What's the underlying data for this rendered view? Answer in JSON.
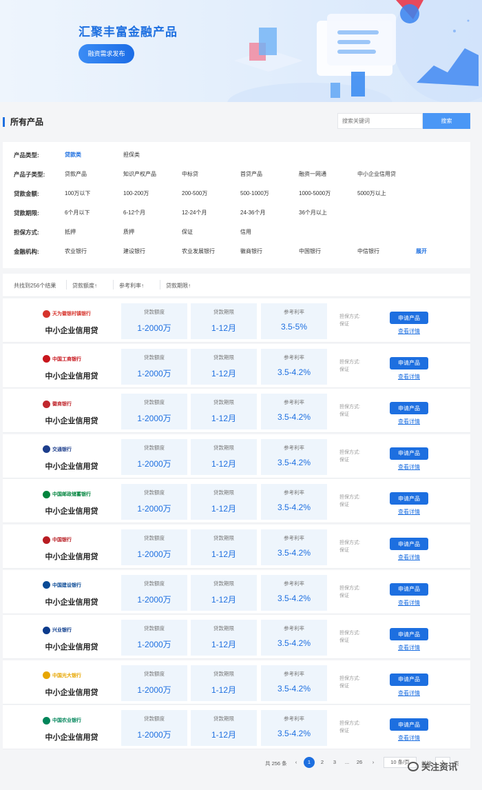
{
  "banner": {
    "title": "汇聚丰富金融产品",
    "button": "融资需求发布"
  },
  "section": {
    "title": "所有产品"
  },
  "search": {
    "placeholder": "搜索关键词",
    "button": "搜索"
  },
  "filters": [
    {
      "label": "产品类型:",
      "options": [
        "贷款类",
        "担保类"
      ],
      "selected": 0
    },
    {
      "label": "产品子类型:",
      "options": [
        "贷款产品",
        "知识产权产品",
        "中标贷",
        "首贷产品",
        "融资一网通",
        "中小企业信用贷"
      ]
    },
    {
      "label": "贷款金额:",
      "options": [
        "100万以下",
        "100-200万",
        "200-500万",
        "500-1000万",
        "1000-5000万",
        "5000万以上"
      ]
    },
    {
      "label": "贷款期限:",
      "options": [
        "6个月以下",
        "6-12个月",
        "12-24个月",
        "24-36个月",
        "36个月以上"
      ]
    },
    {
      "label": "担保方式:",
      "options": [
        "抵押",
        "质押",
        "保证",
        "信用"
      ]
    },
    {
      "label": "金融机构:",
      "options": [
        "农业银行",
        "建设银行",
        "农业发展银行",
        "徽商银行",
        "中国银行",
        "中信银行"
      ],
      "more": "展开"
    }
  ],
  "sortbar": {
    "count": "共找到256个结果",
    "sorts": [
      "贷款额度↑",
      "参考利率↑",
      "贷款期限↑"
    ]
  },
  "stat_labels": {
    "amount": "贷款额度",
    "term": "贷款期限",
    "rate": "参考利率"
  },
  "card_labels": {
    "guarantee": "担保方式:",
    "apply": "申请产品",
    "detail": "查看详情"
  },
  "products": [
    {
      "bank": "天为徽银村镇银行",
      "bank_icon": "village-bank-logo-icon",
      "color": "#d6342c",
      "name": "中小企业信用贷",
      "amount": "1-2000万",
      "term": "1-12月",
      "rate": "3.5-5%",
      "guarantee": "保证"
    },
    {
      "bank": "中国工商银行",
      "bank_icon": "icbc-logo-icon",
      "color": "#c8161d",
      "name": "中小企业信用贷",
      "amount": "1-2000万",
      "term": "1-12月",
      "rate": "3.5-4.2%",
      "guarantee": "保证"
    },
    {
      "bank": "徽商银行",
      "bank_icon": "huishang-bank-logo-icon",
      "color": "#c0272d",
      "name": "中小企业信用贷",
      "amount": "1-2000万",
      "term": "1-12月",
      "rate": "3.5-4.2%",
      "guarantee": "保证"
    },
    {
      "bank": "交通银行",
      "bank_icon": "bocom-logo-icon",
      "color": "#1d3e8c",
      "name": "中小企业信用贷",
      "amount": "1-2000万",
      "term": "1-12月",
      "rate": "3.5-4.2%",
      "guarantee": "保证"
    },
    {
      "bank": "中国邮政储蓄银行",
      "bank_icon": "psbc-logo-icon",
      "color": "#00843d",
      "name": "中小企业信用贷",
      "amount": "1-2000万",
      "term": "1-12月",
      "rate": "3.5-4.2%",
      "guarantee": "保证"
    },
    {
      "bank": "中国银行",
      "bank_icon": "boc-logo-icon",
      "color": "#b81c22",
      "name": "中小企业信用贷",
      "amount": "1-2000万",
      "term": "1-12月",
      "rate": "3.5-4.2%",
      "guarantee": "保证"
    },
    {
      "bank": "中国建设银行",
      "bank_icon": "ccb-logo-icon",
      "color": "#0a4a96",
      "name": "中小企业信用贷",
      "amount": "1-2000万",
      "term": "1-12月",
      "rate": "3.5-4.2%",
      "guarantee": "保证"
    },
    {
      "bank": "兴业银行",
      "bank_icon": "cib-logo-icon",
      "color": "#0b3b8c",
      "name": "中小企业信用贷",
      "amount": "1-2000万",
      "term": "1-12月",
      "rate": "3.5-4.2%",
      "guarantee": "保证"
    },
    {
      "bank": "中国光大银行",
      "bank_icon": "ceb-logo-icon",
      "color": "#e7a600",
      "name": "中小企业信用贷",
      "amount": "1-2000万",
      "term": "1-12月",
      "rate": "3.5-4.2%",
      "guarantee": "保证"
    },
    {
      "bank": "中国农业银行",
      "bank_icon": "abc-logo-icon",
      "color": "#00855a",
      "name": "中小企业信用贷",
      "amount": "1-2000万",
      "term": "1-12月",
      "rate": "3.5-4.2%",
      "guarantee": "保证"
    }
  ],
  "pagination": {
    "total": "共 256 条",
    "pages": [
      "1",
      "2",
      "3",
      "...",
      "26"
    ],
    "current": "1",
    "page_size": "10 条/页",
    "goto_label": "前往",
    "goto_value": "1",
    "page_unit": "页"
  },
  "watermark": "关注资讯"
}
